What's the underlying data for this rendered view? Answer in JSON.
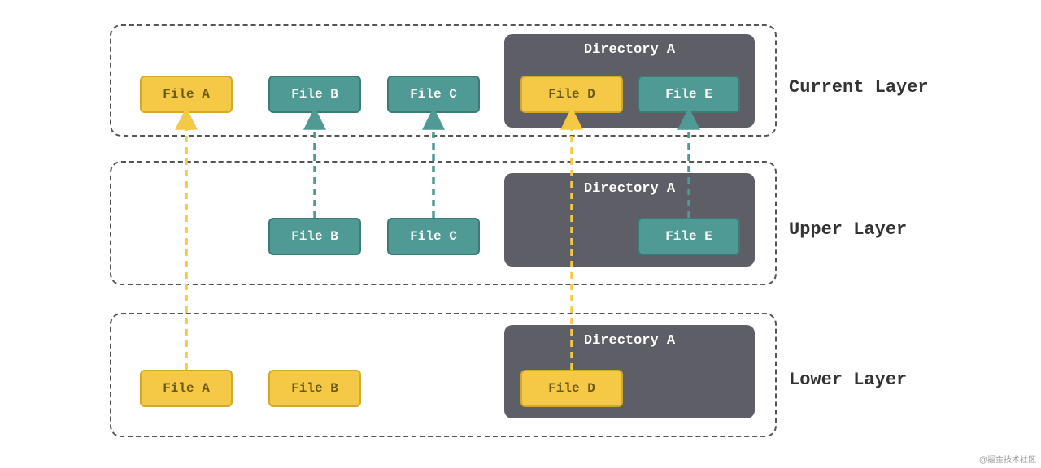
{
  "layers": {
    "current": {
      "label": "Current Layer"
    },
    "upper": {
      "label": "Upper Layer"
    },
    "lower": {
      "label": "Lower Layer"
    }
  },
  "files": {
    "a": "File A",
    "b": "File B",
    "c": "File C",
    "d": "File D",
    "e": "File E"
  },
  "directory": "Directory A",
  "watermark": "@掘金技术社区",
  "arrows": [
    {
      "from": "lowerA",
      "to": "curA",
      "color": "yellow"
    },
    {
      "from": "upperB",
      "to": "curB",
      "color": "teal"
    },
    {
      "from": "upperC",
      "to": "curC",
      "color": "teal"
    },
    {
      "from": "lowerD",
      "to": "curD",
      "color": "yellow"
    },
    {
      "from": "upperE",
      "to": "curE",
      "color": "teal"
    }
  ]
}
